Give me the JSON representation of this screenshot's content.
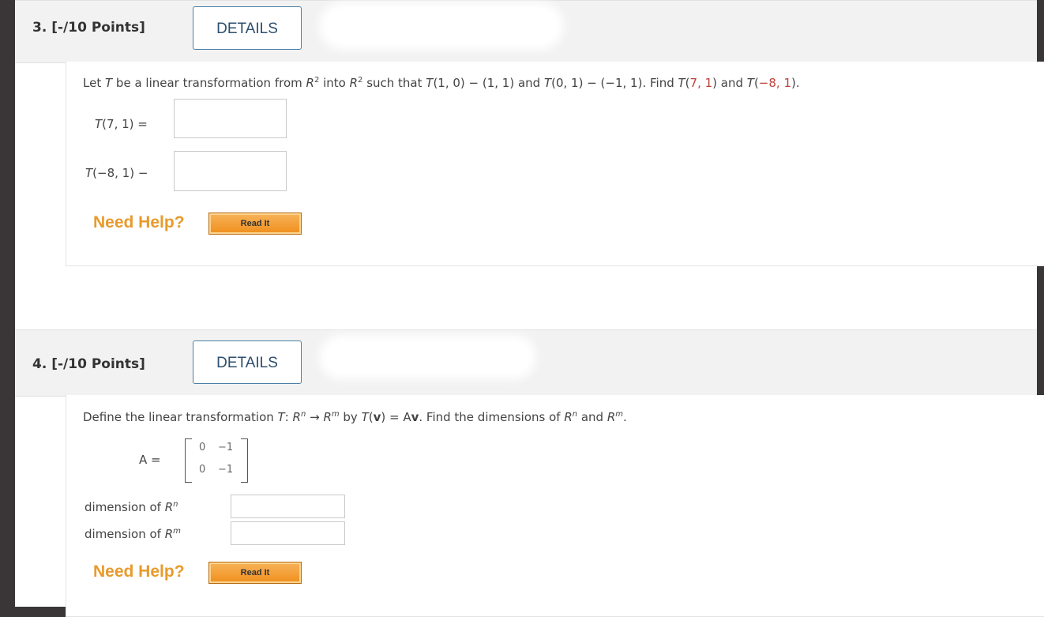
{
  "q3": {
    "title": "3.  [-/10 Points]",
    "details_label": "DETAILS",
    "prompt_pre": "Let ",
    "T": "T",
    "prompt_mid1": " be a linear transformation from ",
    "R": "R",
    "sup2": "2",
    "prompt_mid2": " into ",
    "prompt_mid3": " such that ",
    "cond1": "(1, 0) − (1, 1) and ",
    "cond2": "(0, 1) − (−1, 1). Find ",
    "find1_open": "(",
    "find1_vals": "7, 1",
    "find1_close": ") and ",
    "find2_open": "(",
    "find2_vals": "−8, 1",
    "find2_close": ").",
    "label1": "(7, 1)  =",
    "label2": "(−8, 1)  −",
    "need_help": "Need Help?",
    "read_it": "Read It"
  },
  "q4": {
    "title": "4.  [-/10 Points]",
    "details_label": "DETAILS",
    "prompt_a": "Define the linear transformation ",
    "T": "T",
    "prompt_b": ": ",
    "R": "R",
    "n": "n",
    "m": "m",
    "arrow": " → ",
    "prompt_c": " by ",
    "Tv": "T",
    "prompt_d": "(",
    "v": "v",
    "prompt_e": ") = A",
    "prompt_f": ". Find the dimensions of ",
    "and": " and ",
    "period": ".",
    "A_label": "A  =",
    "matrix": [
      [
        "0",
        "−1"
      ],
      [
        "0",
        "−1"
      ]
    ],
    "dim_n_label": "dimension of ",
    "dim_m_label": "dimension of ",
    "need_help": "Need Help?",
    "read_it": "Read It"
  }
}
